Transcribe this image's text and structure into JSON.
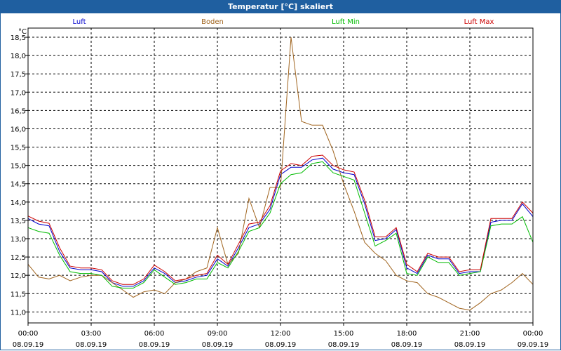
{
  "window": {
    "title": "Temperatur [°C] skaliert"
  },
  "chart_data": {
    "type": "line",
    "title": "Temperatur [°C] skaliert",
    "ylabel": "°C",
    "ylim": [
      10.7,
      18.75
    ],
    "grid": true,
    "legend": "top",
    "y_ticks": [
      "18,5",
      "18,0",
      "17,5",
      "17,0",
      "16,5",
      "16,0",
      "15,5",
      "15,0",
      "14,5",
      "14,0",
      "13,5",
      "13,0",
      "12,5",
      "12,0",
      "11,5",
      "11,0"
    ],
    "y_tick_values": [
      18.5,
      18.0,
      17.5,
      17.0,
      16.5,
      16.0,
      15.5,
      15.0,
      14.5,
      14.0,
      13.5,
      13.0,
      12.5,
      12.0,
      11.5,
      11.0
    ],
    "x_ticks": [
      {
        "time": "00:00",
        "date": "08.09.19"
      },
      {
        "time": "03:00",
        "date": "08.09.19"
      },
      {
        "time": "06:00",
        "date": "08.09.19"
      },
      {
        "time": "09:00",
        "date": "08.09.19"
      },
      {
        "time": "12:00",
        "date": "08.09.19"
      },
      {
        "time": "15:00",
        "date": "08.09.19"
      },
      {
        "time": "18:00",
        "date": "08.09.19"
      },
      {
        "time": "21:00",
        "date": "08.09.19"
      },
      {
        "time": "00:00",
        "date": "09.09.19"
      }
    ],
    "x_hours": [
      0,
      0.5,
      1,
      1.5,
      2,
      2.5,
      3,
      3.5,
      4,
      4.5,
      5,
      5.5,
      6,
      6.5,
      7,
      7.5,
      8,
      8.5,
      9,
      9.5,
      10,
      10.5,
      11,
      11.5,
      12,
      12.5,
      13,
      13.5,
      14,
      14.5,
      15,
      15.5,
      16,
      16.5,
      17,
      17.5,
      18,
      18.5,
      19,
      19.5,
      20,
      20.5,
      21,
      21.5,
      22,
      22.5,
      23,
      23.5,
      24
    ],
    "series": [
      {
        "name": "Luft",
        "color": "#0000cc",
        "values": [
          13.55,
          13.4,
          13.35,
          12.65,
          12.2,
          12.15,
          12.15,
          12.1,
          11.8,
          11.7,
          11.7,
          11.85,
          12.2,
          12.05,
          11.8,
          11.85,
          11.95,
          12.0,
          12.45,
          12.25,
          12.75,
          13.3,
          13.4,
          13.8,
          14.75,
          14.95,
          14.95,
          15.15,
          15.2,
          14.9,
          14.8,
          14.75,
          13.95,
          12.95,
          13.0,
          13.25,
          12.2,
          12.05,
          12.55,
          12.45,
          12.45,
          12.05,
          12.1,
          12.1,
          13.45,
          13.5,
          13.5,
          13.95,
          13.6
        ]
      },
      {
        "name": "Boden",
        "color": "#a0641e",
        "values": [
          12.3,
          11.95,
          11.9,
          12.0,
          11.85,
          11.95,
          12.0,
          12.0,
          11.8,
          11.6,
          11.4,
          11.55,
          11.6,
          11.5,
          11.8,
          11.9,
          12.1,
          12.2,
          13.3,
          12.3,
          12.6,
          14.1,
          13.3,
          14.4,
          14.4,
          18.5,
          16.2,
          16.1,
          16.1,
          15.4,
          14.5,
          13.75,
          12.9,
          12.6,
          12.4,
          12.0,
          11.85,
          11.8,
          11.5,
          11.4,
          11.25,
          11.1,
          11.05,
          11.25,
          11.5,
          11.6,
          11.8,
          12.05,
          11.75
        ]
      },
      {
        "name": "Luft Min",
        "color": "#00bb00",
        "values": [
          13.3,
          13.2,
          13.15,
          12.55,
          12.1,
          12.05,
          12.05,
          12.0,
          11.7,
          11.65,
          11.65,
          11.8,
          12.15,
          11.95,
          11.75,
          11.8,
          11.9,
          11.9,
          12.35,
          12.2,
          12.65,
          13.2,
          13.3,
          13.7,
          14.5,
          14.75,
          14.8,
          15.05,
          15.1,
          14.8,
          14.7,
          14.6,
          13.7,
          12.8,
          12.95,
          13.15,
          12.05,
          12.0,
          12.5,
          12.35,
          12.35,
          12.0,
          12.05,
          12.1,
          13.35,
          13.4,
          13.4,
          13.6,
          12.9
        ]
      },
      {
        "name": "Luft Max",
        "color": "#cc0000",
        "values": [
          13.62,
          13.48,
          13.42,
          12.75,
          12.25,
          12.2,
          12.2,
          12.15,
          11.85,
          11.75,
          11.75,
          11.9,
          12.28,
          12.1,
          11.85,
          11.9,
          12.0,
          12.05,
          12.55,
          12.3,
          12.85,
          13.4,
          13.45,
          13.9,
          14.85,
          15.05,
          15.0,
          15.25,
          15.28,
          15.0,
          14.88,
          14.82,
          14.05,
          13.05,
          13.05,
          13.3,
          12.3,
          12.1,
          12.6,
          12.5,
          12.5,
          12.1,
          12.15,
          12.15,
          13.55,
          13.55,
          13.55,
          14.0,
          13.7
        ]
      }
    ]
  }
}
